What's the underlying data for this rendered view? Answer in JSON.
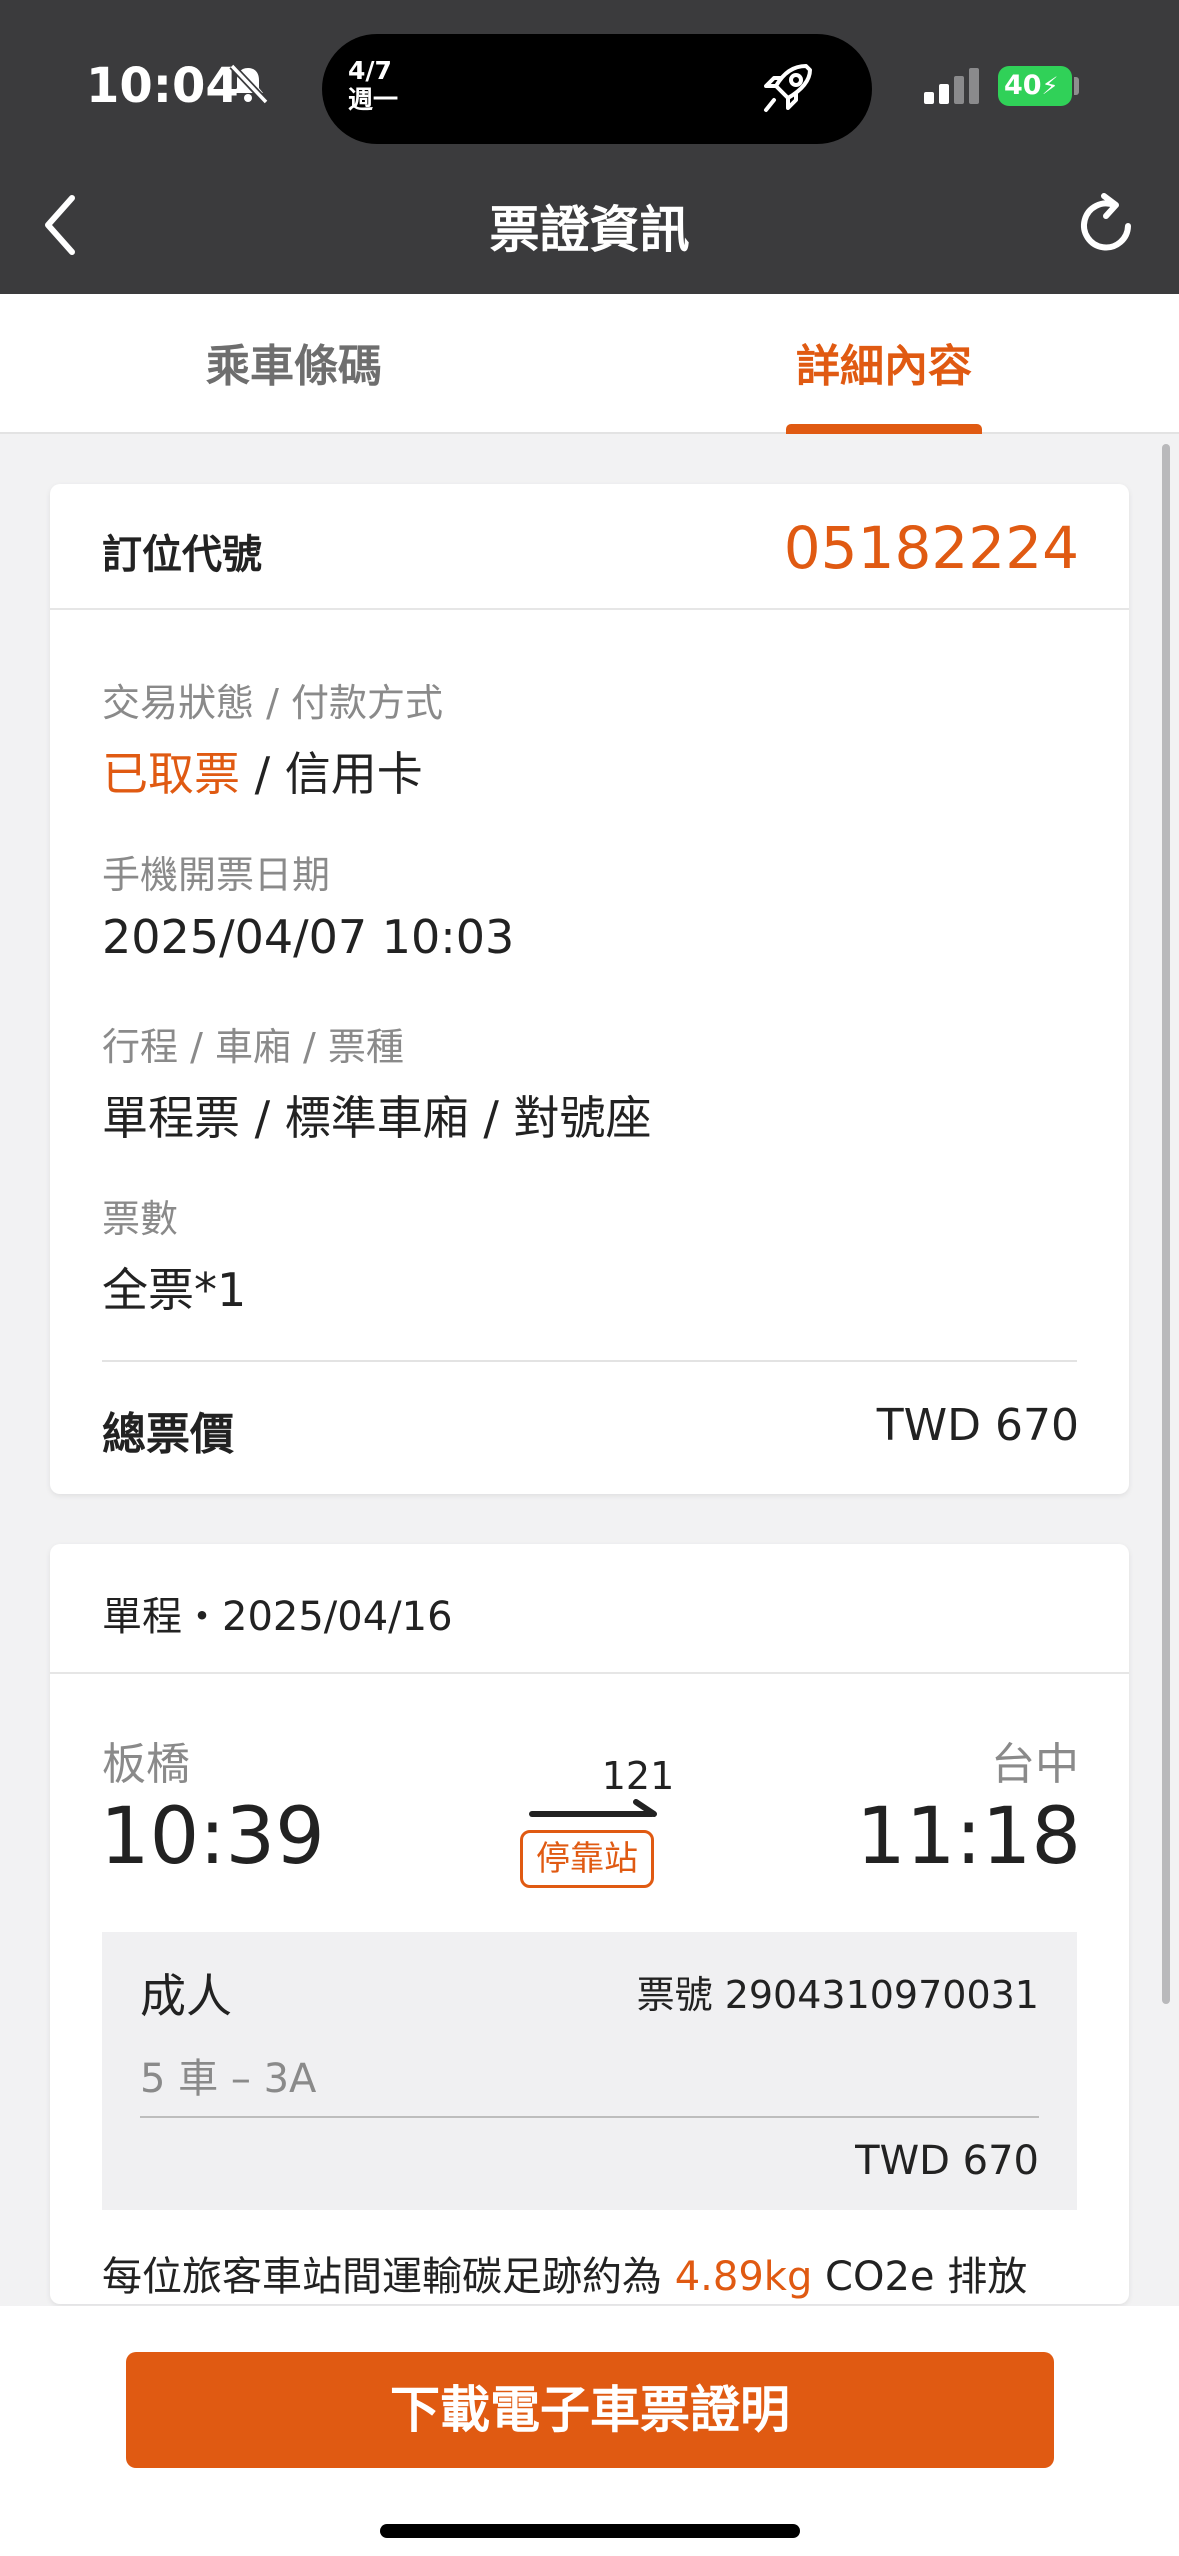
{
  "status_bar": {
    "time": "10:04",
    "island_date": "4/7",
    "island_weekday": "週一",
    "battery": "40"
  },
  "header": {
    "title": "票證資訊"
  },
  "tabs": [
    {
      "label": "乘車條碼",
      "active": false
    },
    {
      "label": "詳細內容",
      "active": true
    }
  ],
  "booking": {
    "pnr_label": "訂位代號",
    "pnr": "05182224",
    "status_label": "交易狀態 / 付款方式",
    "status": "已取票",
    "separator": " / ",
    "payment": "信用卡",
    "issue_label": "手機開票日期",
    "issue_date": "2025/04/07 10:03",
    "trip_label": "行程 / 車廂 / 票種",
    "trip_value": "單程票 / 標準車廂 / 對號座",
    "count_label": "票數",
    "count_value": "全票*1",
    "total_label": "總票價",
    "total_value": "TWD 670"
  },
  "trip": {
    "header": "單程・2025/04/16",
    "from_station": "板橋",
    "from_time": "10:39",
    "to_station": "台中",
    "to_time": "11:18",
    "train_no": "121",
    "stop_type": "停靠站",
    "passenger_type": "成人",
    "ticket_no": "票號 2904310970031",
    "seat": "5 車 – 3A",
    "price": "TWD 670",
    "carbon_prefix": "每位旅客車站間運輸碳足跡約為 ",
    "carbon_value": "4.89kg",
    "carbon_suffix": " CO2e 排放"
  },
  "bottom": {
    "download_label": "下載電子車票證明"
  },
  "colors": {
    "accent": "#e05a12",
    "header_bg": "#3b3b3d",
    "battery": "#30d158"
  }
}
